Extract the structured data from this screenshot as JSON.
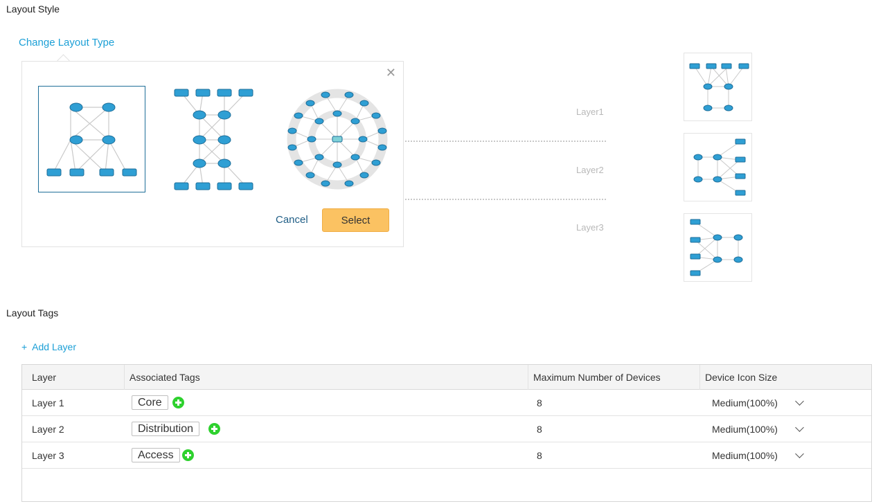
{
  "sections": {
    "layout_style": "Layout Style",
    "layout_tags": "Layout Tags"
  },
  "change_layout_link": "Change Layout Type",
  "popover": {
    "options": [
      {
        "name": "layout-option-hierarchical",
        "selected": true
      },
      {
        "name": "layout-option-mirrored",
        "selected": false
      },
      {
        "name": "layout-option-radial",
        "selected": false
      }
    ],
    "close_icon": "close-icon",
    "cancel_label": "Cancel",
    "select_label": "Select"
  },
  "preview": {
    "layers": [
      "Layer1",
      "Layer2",
      "Layer3"
    ]
  },
  "add_layer_label": "+  Add Layer",
  "table": {
    "headers": [
      "Layer",
      "Associated Tags",
      "Maximum Number of Devices",
      "Device Icon Size"
    ],
    "rows": [
      {
        "layer": "Layer 1",
        "tag": "Core",
        "max": "8",
        "size": "Medium(100%)"
      },
      {
        "layer": "Layer 2",
        "tag": "Distribution",
        "max": "8",
        "size": "Medium(100%)"
      },
      {
        "layer": "Layer 3",
        "tag": "Access",
        "max": "8",
        "size": "Medium(100%)"
      }
    ]
  },
  "colors": {
    "accent": "#1b9fd6",
    "select_button": "#fbc262",
    "add_tag": "#2ed12e",
    "selected_border": "#1e6e98"
  }
}
